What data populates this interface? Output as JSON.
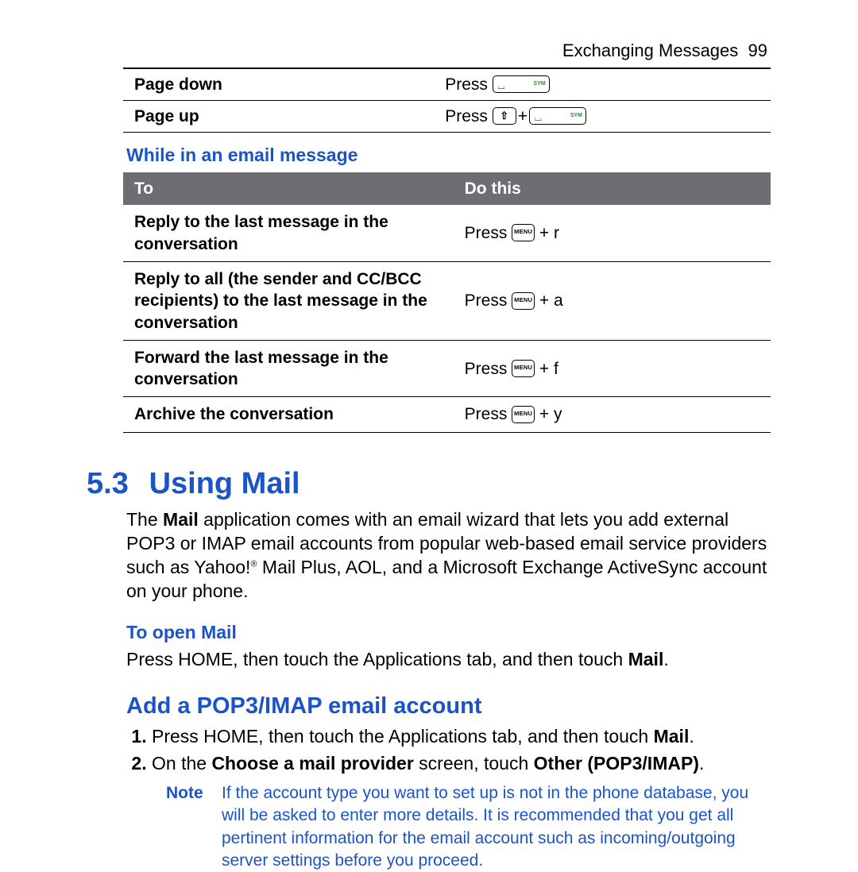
{
  "header": {
    "section": "Exchanging Messages",
    "page": "99"
  },
  "navtable": {
    "rows": [
      {
        "label": "Page down",
        "press": "Press"
      },
      {
        "label": "Page up",
        "press": "Press"
      }
    ]
  },
  "sub1": "While in an email message",
  "table2": {
    "head": {
      "c1": "To",
      "c2": "Do this"
    },
    "rows": [
      {
        "c1": "Reply to the last message in the conversation",
        "press": "Press",
        "suffix": " + r"
      },
      {
        "c1": "Reply to all (the sender and CC/BCC recipients) to the last message in the conversation",
        "press": "Press",
        "suffix": " + a"
      },
      {
        "c1": "Forward the last message in the conversation",
        "press": "Press",
        "suffix": " + f"
      },
      {
        "c1": "Archive the conversation",
        "press": "Press",
        "suffix": " + y"
      }
    ]
  },
  "section": {
    "num": "5.3",
    "title": "Using Mail"
  },
  "para1_pre": "The ",
  "para1_bold": "Mail",
  "para1_post": " application comes with an email wizard that lets you add external POP3 or IMAP email accounts from popular web-based email service providers such as Yahoo!",
  "para1_after_sup": " Mail Plus, AOL, and a Microsoft Exchange ActiveSync account on your phone.",
  "sub2": "To open Mail",
  "para2_pre": "Press HOME, then touch the Applications tab, and then touch ",
  "para2_bold": "Mail",
  "para2_post": ".",
  "sub3": "Add a POP3/IMAP email account",
  "steps": [
    {
      "pre": "Press HOME, then touch the Applications tab, and then touch ",
      "b1": "Mail",
      "post": "."
    },
    {
      "pre": "On the ",
      "b1": "Choose a mail provider",
      "mid": " screen, touch ",
      "b2": "Other (POP3/IMAP)",
      "post": "."
    }
  ],
  "note": {
    "label": "Note",
    "text": "If the account type you want to set up is not in the phone database, you will be asked to enter more details. It is recommended that you get all pertinent information for the email account such as incoming/outgoing server settings before you proceed."
  },
  "keys": {
    "menu": "MENU",
    "sym": "SYM"
  }
}
